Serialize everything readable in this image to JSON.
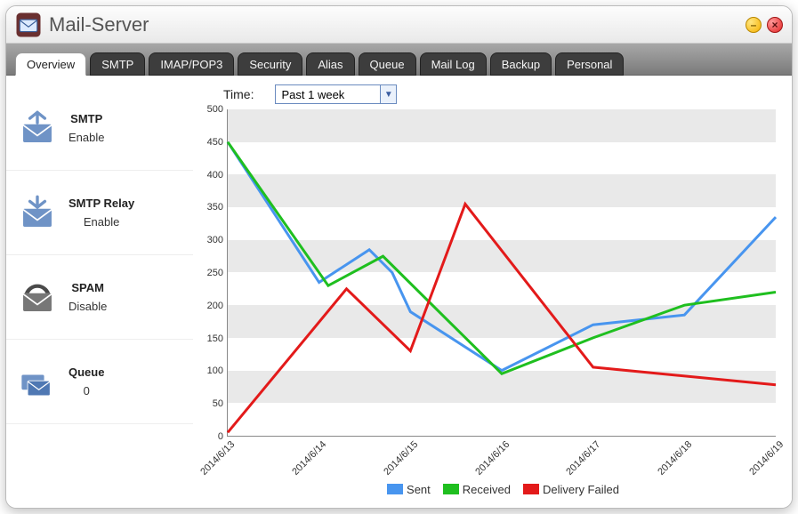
{
  "window": {
    "title": "Mail-Server"
  },
  "tabs": [
    {
      "label": "Overview",
      "active": true
    },
    {
      "label": "SMTP",
      "active": false
    },
    {
      "label": "IMAP/POP3",
      "active": false
    },
    {
      "label": "Security",
      "active": false
    },
    {
      "label": "Alias",
      "active": false
    },
    {
      "label": "Queue",
      "active": false
    },
    {
      "label": "Mail Log",
      "active": false
    },
    {
      "label": "Backup",
      "active": false
    },
    {
      "label": "Personal",
      "active": false
    }
  ],
  "sidebar": [
    {
      "icon": "smtp-out-icon",
      "label": "SMTP",
      "value": "Enable"
    },
    {
      "icon": "smtp-relay-icon",
      "label": "SMTP Relay",
      "value": "Enable"
    },
    {
      "icon": "spam-icon",
      "label": "SPAM",
      "value": "Disable"
    },
    {
      "icon": "queue-icon",
      "label": "Queue",
      "value": "0"
    }
  ],
  "time": {
    "label": "Time:",
    "selected": "Past 1 week"
  },
  "chart_data": {
    "type": "line",
    "title": "",
    "xlabel": "",
    "ylabel": "",
    "ylim": [
      0,
      500
    ],
    "yticks": [
      0,
      50,
      100,
      150,
      200,
      250,
      300,
      350,
      400,
      450,
      500
    ],
    "categories": [
      "2014/6/13",
      "2014/6/14",
      "2014/6/15",
      "2014/6/16",
      "2014/6/17",
      "2014/6/18",
      "2014/6/19"
    ],
    "series": [
      {
        "name": "Sent",
        "color": "#4895ef",
        "values": [
          450,
          235,
          285,
          100,
          170,
          185,
          335
        ]
      },
      {
        "name": "Received",
        "color": "#1fbf1f",
        "values": [
          450,
          230,
          275,
          95,
          150,
          200,
          220
        ]
      },
      {
        "name": "Delivery Failed",
        "color": "#e31a1a",
        "values": [
          5,
          225,
          130,
          355,
          105,
          90,
          78
        ]
      }
    ],
    "extra_points": {
      "note": "intermediate visual points between categories, for recreation only; indices are fractional positions on x-axis",
      "Sent": [
        [
          0,
          450
        ],
        [
          1,
          235
        ],
        [
          1.55,
          285
        ],
        [
          1.8,
          250
        ],
        [
          2,
          190
        ],
        [
          3,
          100
        ],
        [
          4,
          170
        ],
        [
          5,
          185
        ],
        [
          6,
          335
        ]
      ],
      "Received": [
        [
          0,
          450
        ],
        [
          1.1,
          230
        ],
        [
          1.7,
          275
        ],
        [
          3,
          95
        ],
        [
          4,
          150
        ],
        [
          5,
          200
        ],
        [
          6,
          220
        ]
      ],
      "Delivery Failed": [
        [
          0,
          5
        ],
        [
          1.3,
          225
        ],
        [
          2,
          130
        ],
        [
          2.6,
          355
        ],
        [
          4,
          105
        ],
        [
          6,
          78
        ]
      ]
    }
  }
}
